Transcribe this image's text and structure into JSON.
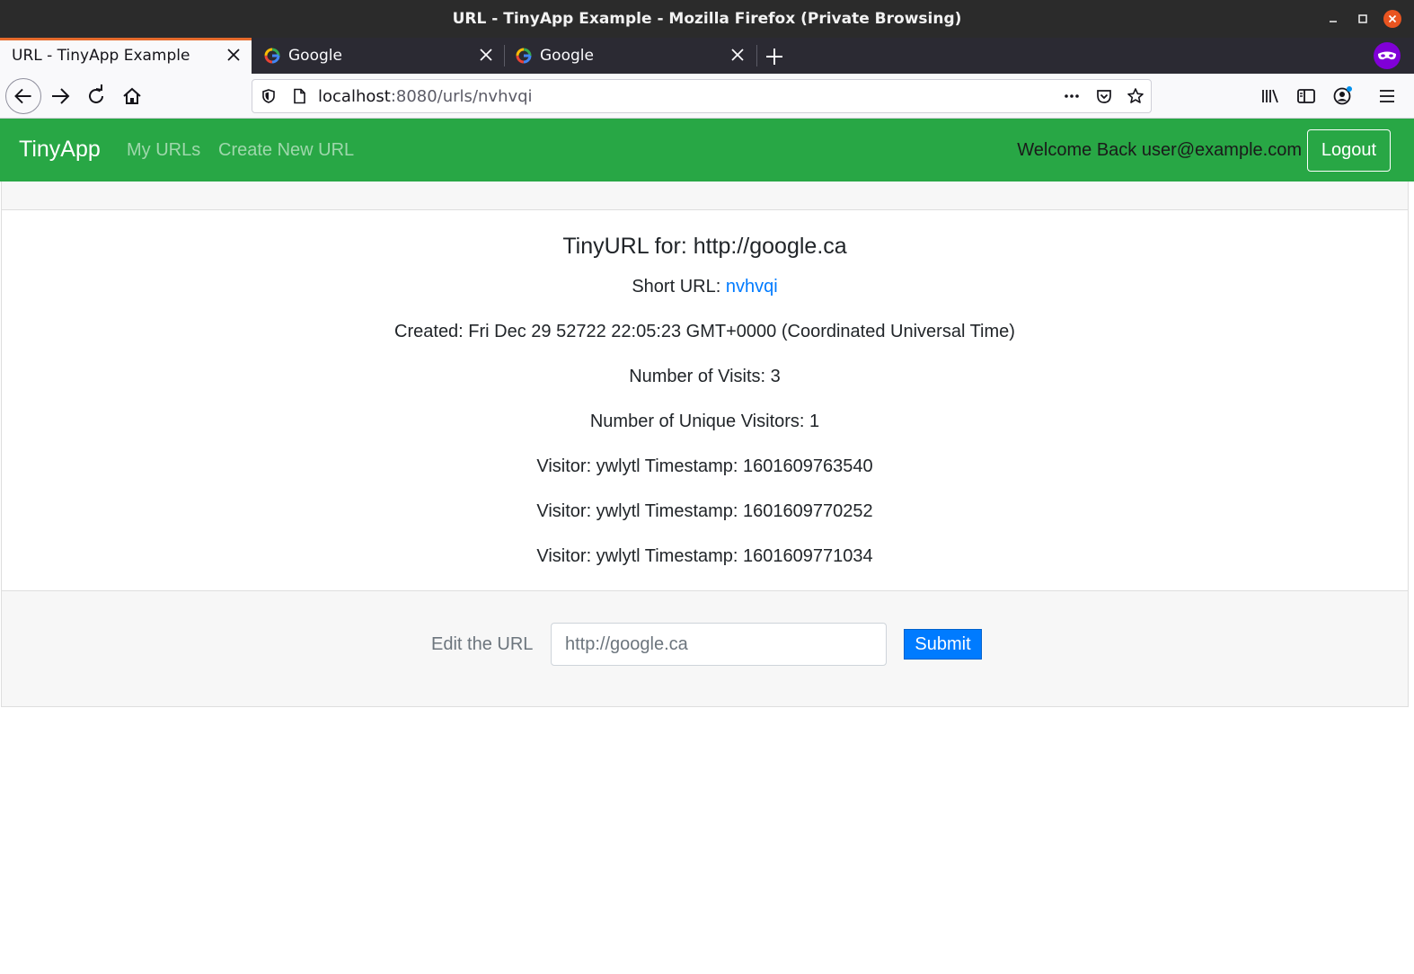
{
  "window": {
    "title": "URL - TinyApp Example - Mozilla Firefox (Private Browsing)"
  },
  "tabs": [
    {
      "label": "URL - TinyApp Example",
      "active": true
    },
    {
      "label": "Google",
      "active": false,
      "favicon": "google-icon"
    },
    {
      "label": "Google",
      "active": false,
      "favicon": "google-icon"
    }
  ],
  "addressbar": {
    "host": "localhost",
    "path": ":8080/urls/nvhvqi"
  },
  "app": {
    "brand": "TinyApp",
    "nav_links": [
      "My URLs",
      "Create New URL"
    ],
    "welcome": "Welcome Back user@example.com",
    "logout_label": "Logout",
    "accent_color": "#28a745"
  },
  "url_detail": {
    "title": "TinyURL for: http://google.ca",
    "short_url_label": "Short URL: ",
    "short_url": "nvhvqi",
    "created": "Created: Fri Dec 29 52722 22:05:23 GMT+0000 (Coordinated Universal Time)",
    "visits": "Number of Visits: 3",
    "unique_visitors": "Number of Unique Visitors: 1",
    "visitor_log": [
      "Visitor: ywlytl Timestamp: 1601609763540",
      "Visitor: ywlytl Timestamp: 1601609770252",
      "Visitor: ywlytl Timestamp: 1601609771034"
    ]
  },
  "edit_form": {
    "label": "Edit the URL",
    "placeholder": "http://google.ca",
    "submit_label": "Submit"
  }
}
